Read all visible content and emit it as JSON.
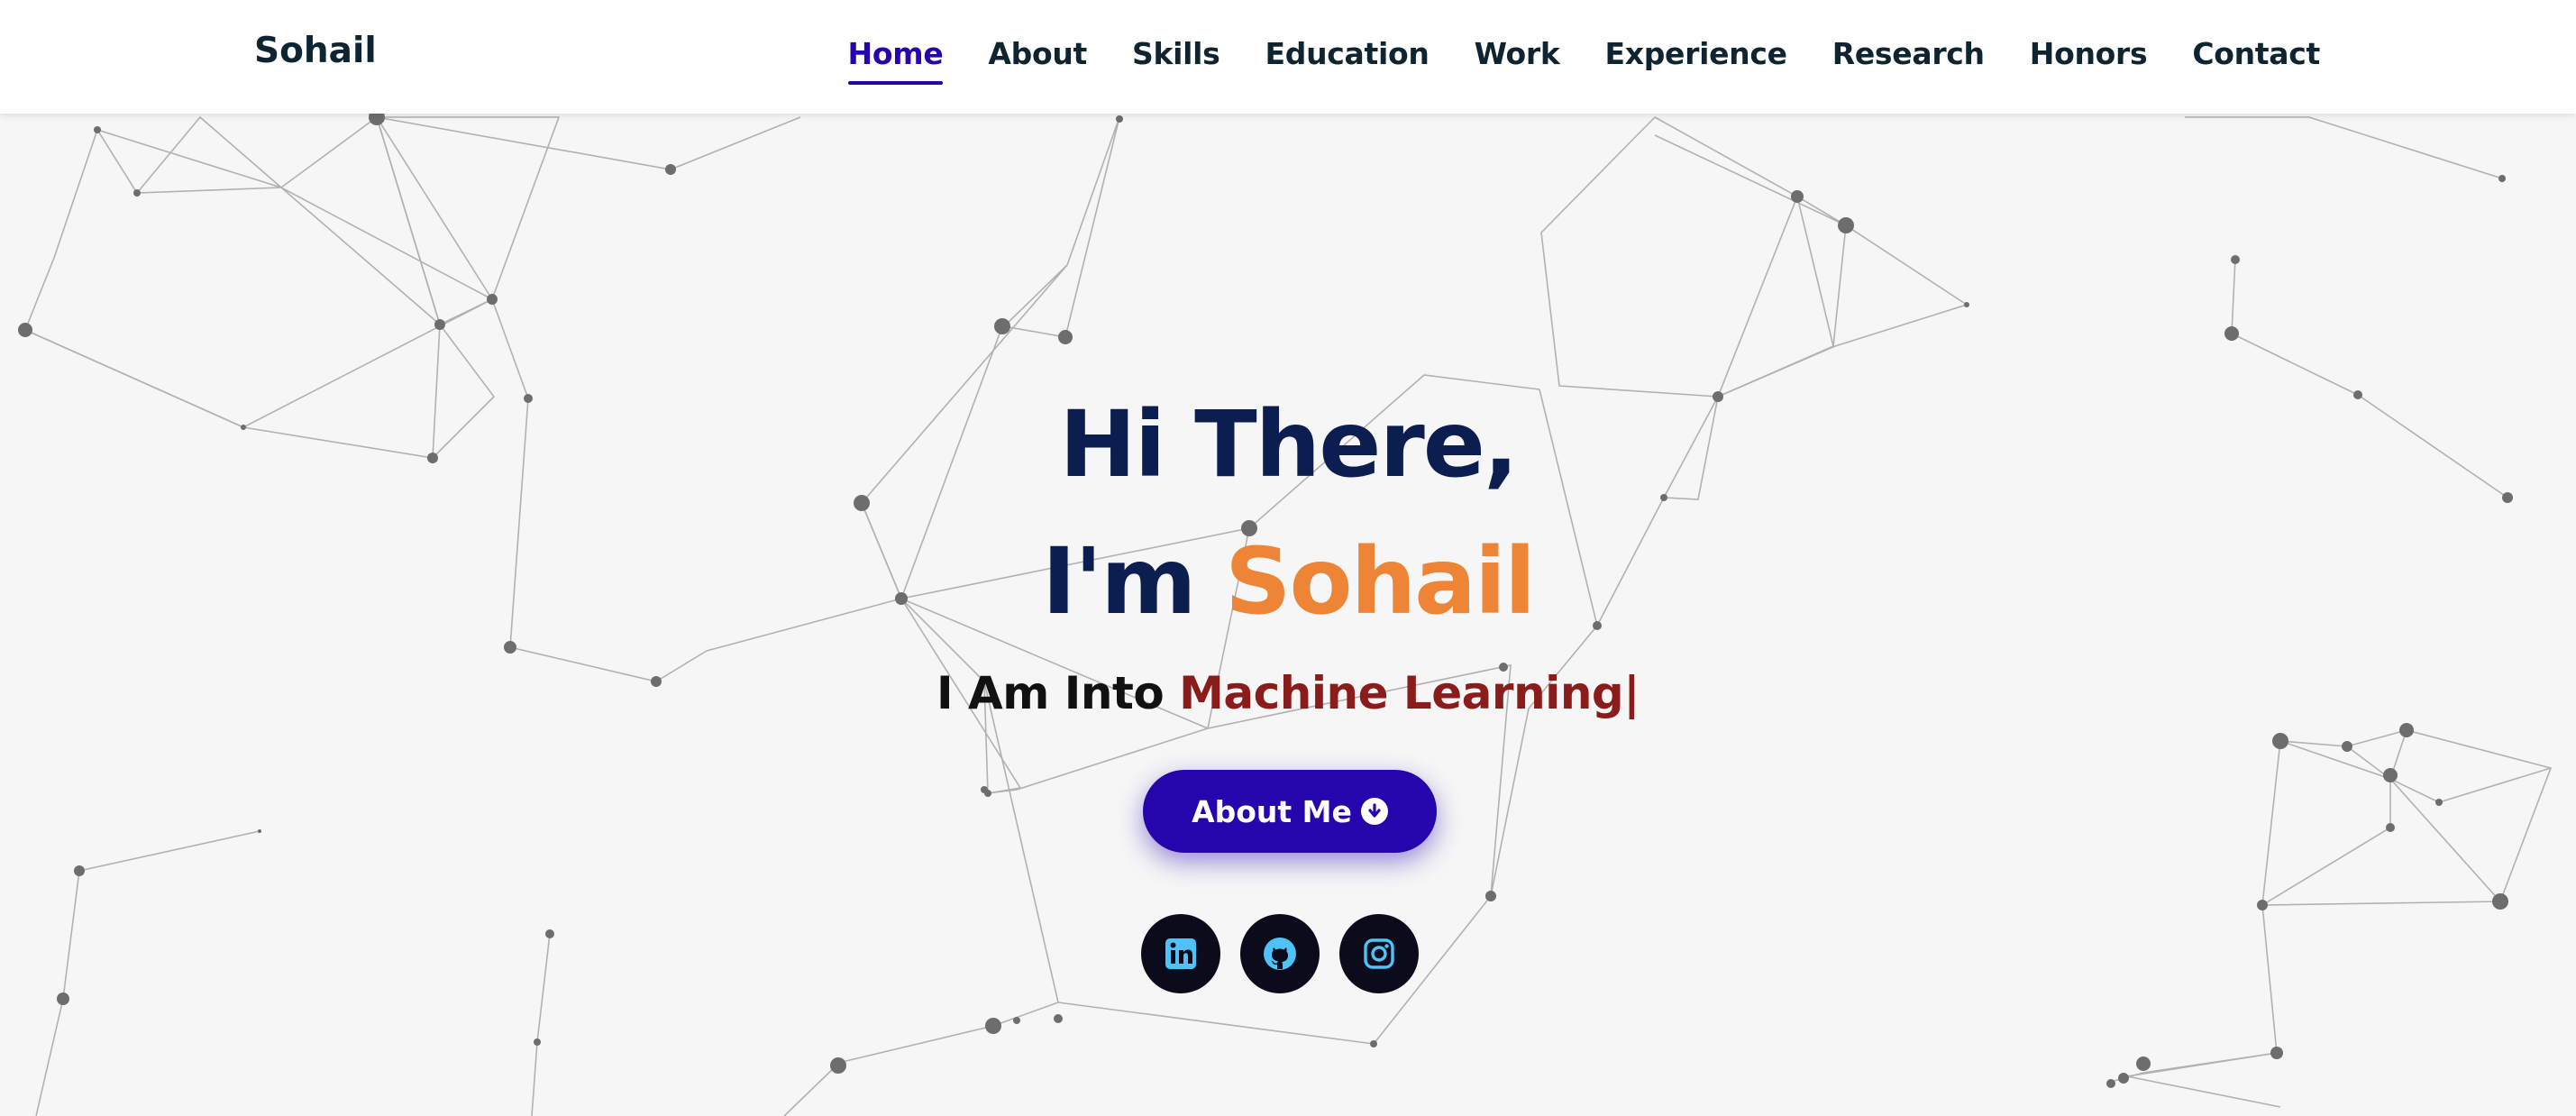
{
  "header": {
    "brand": "Sohail",
    "nav": [
      {
        "label": "Home",
        "active": true
      },
      {
        "label": "About"
      },
      {
        "label": "Skills"
      },
      {
        "label": "Education"
      },
      {
        "label": "Work"
      },
      {
        "label": "Experience"
      },
      {
        "label": "Research"
      },
      {
        "label": "Honors"
      },
      {
        "label": "Contact"
      }
    ]
  },
  "hero": {
    "greeting": "Hi There,",
    "intro_prefix": "I'm",
    "name": "Sohail",
    "tagline_prefix": "I Am Into",
    "tagline_typed": "Machine Learning",
    "cursor": "|",
    "button_label": "About Me",
    "button_icon": "arrow-circle-down-icon",
    "socials": [
      {
        "icon": "linkedin-icon"
      },
      {
        "icon": "github-icon"
      },
      {
        "icon": "instagram-icon"
      }
    ]
  },
  "colors": {
    "accent": "#2506ad",
    "name_orange": "#ee8436",
    "typed_red": "#8b1c1c",
    "heading_navy": "#0c1e4f",
    "social_icon": "#4fc3f7",
    "background": "#f6f6f6"
  }
}
